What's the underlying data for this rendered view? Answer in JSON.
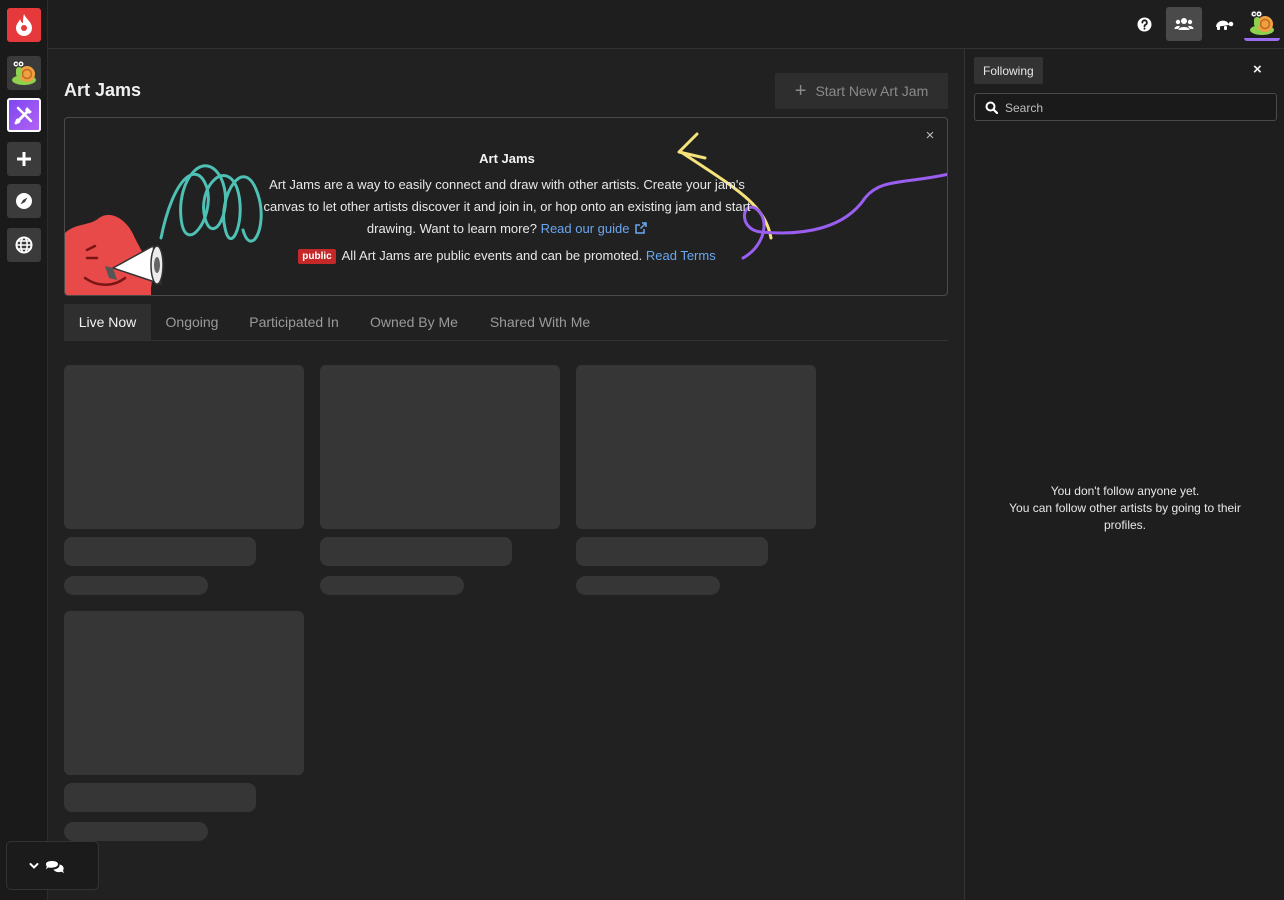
{
  "rail": {
    "items": [
      {
        "name": "home-logo",
        "icon": "fire-drop-icon"
      },
      {
        "name": "user-avatar",
        "icon": "snail-avatar-icon"
      },
      {
        "name": "art-jams",
        "icon": "paint-tools-icon"
      },
      {
        "name": "create",
        "icon": "plus-icon"
      },
      {
        "name": "explore",
        "icon": "compass-icon"
      },
      {
        "name": "community",
        "icon": "globe-icon"
      }
    ]
  },
  "topbar": {
    "icons": [
      "help-icon",
      "friends-icon",
      "turtle-icon",
      "snail-avatar-icon"
    ]
  },
  "page": {
    "title": "Art Jams",
    "new_jam_label": "Start New Art Jam"
  },
  "banner": {
    "title": "Art Jams",
    "text": "Art Jams are a way to easily connect and draw with other artists. Create your jam's canvas to let other artists discover it and join in, or hop onto an existing jam and start drawing. Want to learn more?",
    "guide_link": "Read our guide",
    "badge": "public",
    "note": "All Art Jams are public events and can be promoted.",
    "terms_link": "Read Terms",
    "close": "×"
  },
  "tabs": [
    {
      "label": "Live Now",
      "active": true
    },
    {
      "label": "Ongoing",
      "active": false
    },
    {
      "label": "Participated In",
      "active": false
    },
    {
      "label": "Owned By Me",
      "active": false
    },
    {
      "label": "Shared With Me",
      "active": false
    }
  ],
  "following": {
    "tab_label": "Following",
    "close": "×",
    "search_placeholder": "Search",
    "empty_line1": "You don't follow anyone yet.",
    "empty_line2": "You can follow other artists by going to their profiles."
  },
  "colors": {
    "accent_red": "#e5393b",
    "accent_purple": "#9c6cf0",
    "link": "#6aa7f0",
    "badge_red": "#c42828"
  }
}
